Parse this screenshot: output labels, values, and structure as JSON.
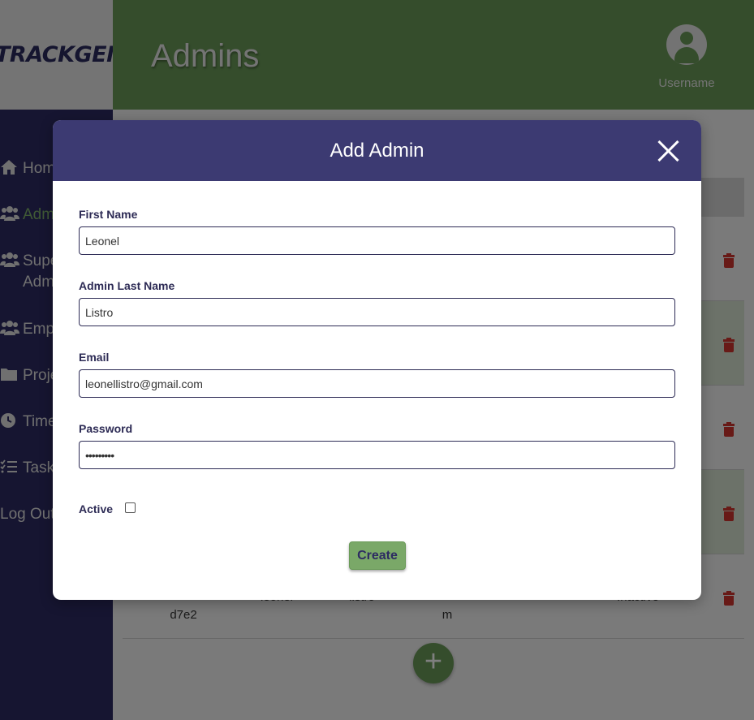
{
  "app": {
    "logo": "TRACKGENIX",
    "page_title": "Admins",
    "username": "Username"
  },
  "sidebar": {
    "items": [
      {
        "label": "Home",
        "icon": "home-icon"
      },
      {
        "label": "Admins",
        "icon": "users-icon",
        "active": true
      },
      {
        "label": "Super Admins",
        "icon": "users-icon"
      },
      {
        "label": "Employees",
        "icon": "users-icon"
      },
      {
        "label": "Projects",
        "icon": "folder-icon"
      },
      {
        "label": "Timesheets",
        "icon": "clock-icon"
      },
      {
        "label": "Tasks",
        "icon": "tasks-icon"
      },
      {
        "label": "Log Out",
        "icon": ""
      }
    ]
  },
  "table": {
    "last_row": {
      "id": "d7e2",
      "name": "leonel",
      "last_name": "listro",
      "email": "m",
      "status": "Inactive"
    }
  },
  "modal": {
    "title": "Add Admin",
    "fields": {
      "first_name": {
        "label": "First Name",
        "value": "Leonel"
      },
      "last_name": {
        "label": "Admin Last Name",
        "value": "Listro"
      },
      "email": {
        "label": "Email",
        "value": "leonellistro@gmail.com"
      },
      "password": {
        "label": "Password",
        "value": "•••••••••"
      }
    },
    "active_label": "Active",
    "active_checked": false,
    "create_label": "Create"
  },
  "colors": {
    "header": "#6a9a58",
    "sidebar": "#2d2b62",
    "modal_header": "#3c3a72",
    "accent": "#7aa868",
    "danger": "#d0352f"
  }
}
